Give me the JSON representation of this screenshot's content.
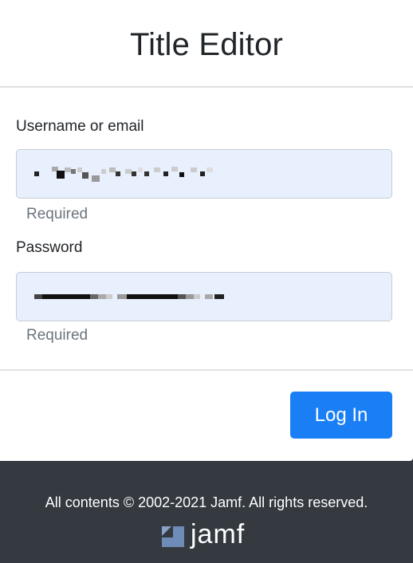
{
  "header": {
    "title": "Title Editor"
  },
  "form": {
    "username": {
      "label": "Username or email",
      "hint": "Required"
    },
    "password": {
      "label": "Password",
      "hint": "Required"
    },
    "submit_label": "Log In"
  },
  "footer": {
    "copyright": "All contents © 2002-2021 Jamf. All rights reserved.",
    "logo_text": "jamf"
  },
  "colors": {
    "primary": "#1a7ff5",
    "field_bg": "#e8f0fe",
    "footer_bg": "#343a40"
  }
}
